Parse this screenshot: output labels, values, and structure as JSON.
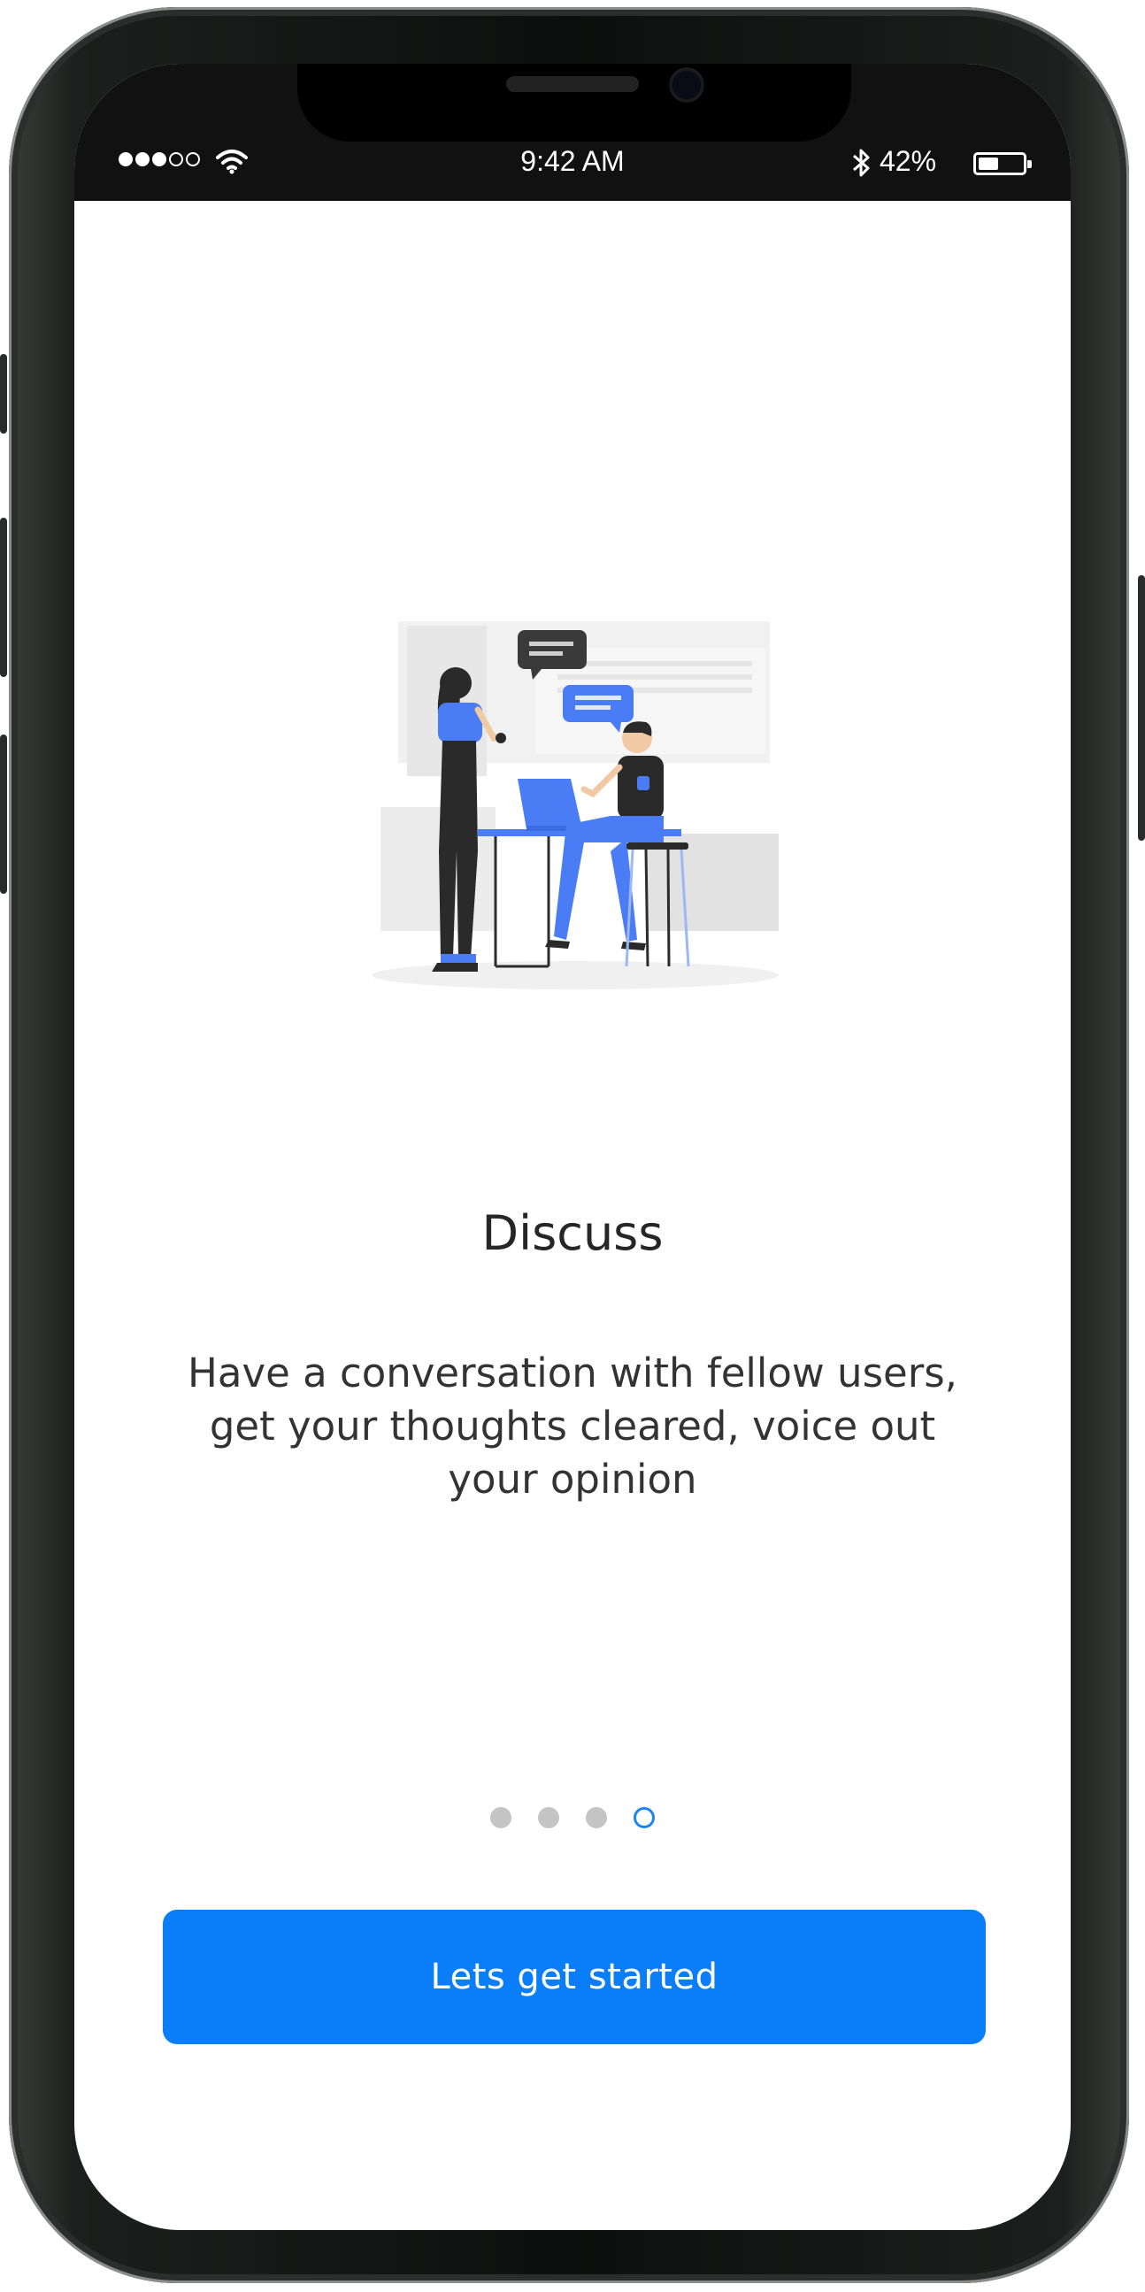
{
  "status_bar": {
    "signal_icon": "signal-dots-icon",
    "wifi_icon": "wifi-icon",
    "time": "9:42 AM",
    "bluetooth_icon": "bluetooth-icon",
    "battery_percent": "42%",
    "battery_level": 0.42
  },
  "onboarding": {
    "illustration": "two-people-discussion-illustration",
    "title": "Discuss",
    "description": "Have a conversation with fellow users, get your thoughts cleared, voice out your opinion",
    "pager": {
      "total_pages": 4,
      "active_page": 4
    },
    "cta_label": "Lets get started"
  },
  "colors": {
    "accent": "#0a7ef8",
    "illustration_blue": "#4a7cf5",
    "status_bar_bg": "#111111"
  }
}
